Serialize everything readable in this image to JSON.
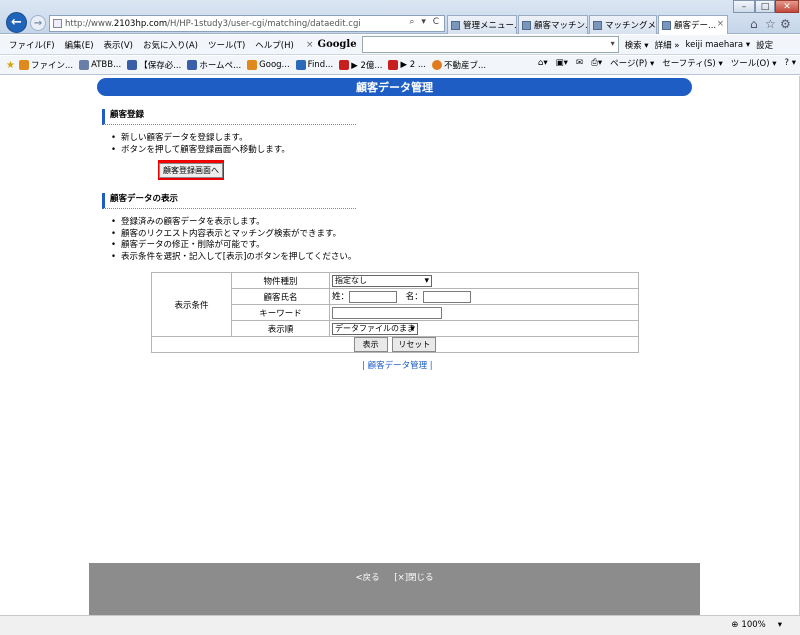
{
  "browser": {
    "url_prefix": "http://www.",
    "url_host": "2103hp.com",
    "url_path": "/H/HP-1study3/user-cgi/matching/dataedit.cgi",
    "url_tools": "⌕ ▾ C",
    "tabs": [
      "管理メニュー...",
      "顧客マッチン...",
      "マッチングメ...",
      "顧客デー..."
    ],
    "tab_close": "×",
    "window_controls": {
      "minimize": "–",
      "maximize": "□",
      "close": "✕"
    },
    "menu": [
      "ファイル(F)",
      "編集(E)",
      "表示(V)",
      "お気に入り(A)",
      "ツール(T)",
      "ヘルプ(H)"
    ],
    "google": {
      "close": "×",
      "logo": "Google",
      "dropdown": "▾",
      "search_btn": "検索 ▾",
      "detail": "詳細 »",
      "user": "keiji maehara ▾",
      "settings": "設定"
    },
    "favorites": [
      {
        "label": "ファイン...",
        "color": "#e08a1e"
      },
      {
        "label": "ATBB...",
        "color": "#6a7fa8"
      },
      {
        "label": "【保存必...",
        "color": "#3a5fa8"
      },
      {
        "label": "ホームペ...",
        "color": "#3a5fa8"
      },
      {
        "label": "Goog...",
        "color": "#e08a1e"
      },
      {
        "label": "Find...",
        "color": "#2a6ab8"
      },
      {
        "label": "▶ 2億...",
        "color": "#c81e1e"
      },
      {
        "label": "▶ 2 ...",
        "color": "#c81e1e"
      },
      {
        "label": "不動産ブ...",
        "color": "#e07b1e"
      }
    ],
    "command_bar": [
      "ページ(P) ▾",
      "セーフティ(S) ▾",
      "ツール(O) ▾",
      "? ▾"
    ],
    "zoom": "100%"
  },
  "page": {
    "banner_title": "顧客データ管理",
    "register_section": {
      "heading": "顧客登録",
      "bullets": [
        "新しい顧客データを登録します。",
        "ボタンを押して顧客登録画面へ移動します。"
      ],
      "button_label": "顧客登録画面へ"
    },
    "display_section": {
      "heading": "顧客データの表示",
      "bullets": [
        "登録済みの顧客データを表示します。",
        "顧客のリクエスト内容表示とマッチング検索ができます。",
        "顧客データの修正・削除が可能です。",
        "表示条件を選択・記入して[表示]のボタンを押してください。"
      ]
    },
    "conditions": {
      "group_label": "表示条件",
      "property_type_label": "物件種別",
      "property_type_value": "指定なし",
      "name_label": "顧客氏名",
      "surname_label": "姓：",
      "firstname_label": "名：",
      "surname_value": "",
      "firstname_value": "",
      "keyword_label": "キーワード",
      "keyword_value": "",
      "order_label": "表示順",
      "order_value": "データファイルのまま",
      "show_button": "表示",
      "reset_button": "リセット"
    },
    "footer_link": "| 顧客データ管理 |",
    "footer_back": "<戻る",
    "footer_close": "[×]閉じる"
  }
}
